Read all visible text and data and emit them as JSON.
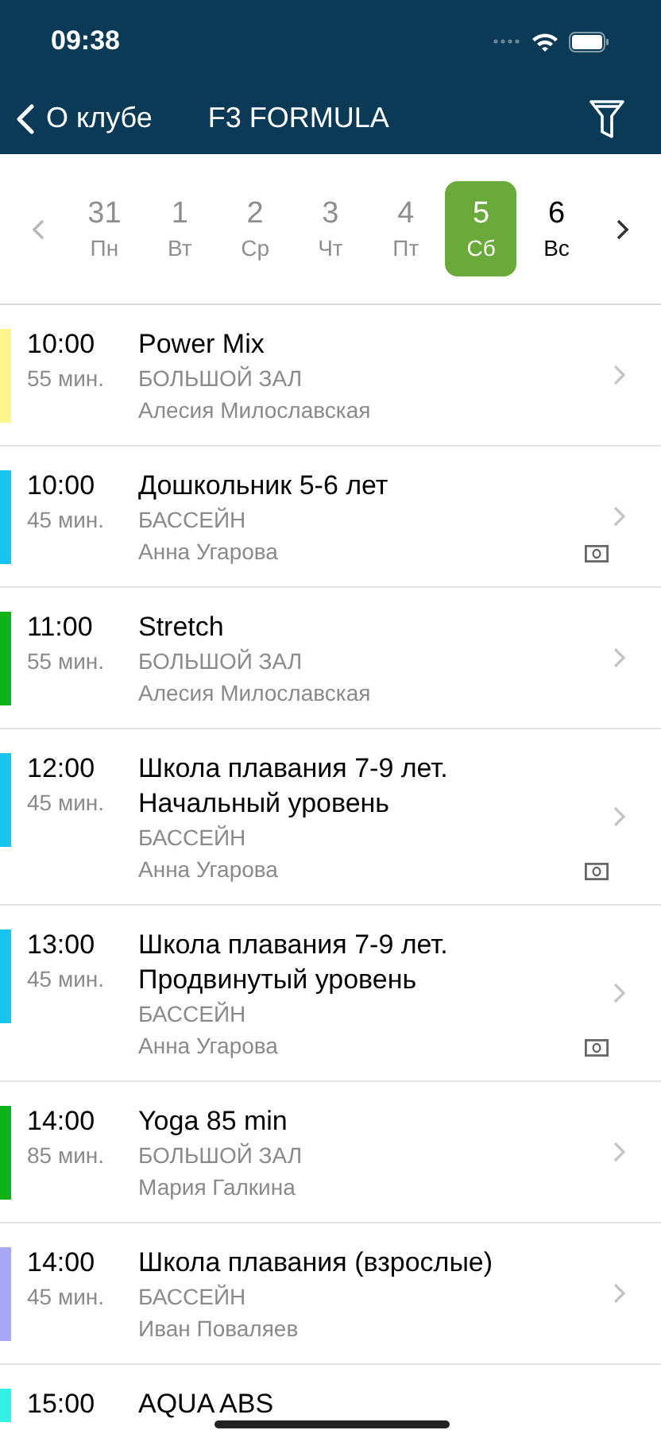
{
  "status_bar": {
    "time": "09:38"
  },
  "nav": {
    "back": "О клубе",
    "title": "F3 FORMULA"
  },
  "days": [
    {
      "number": "31",
      "weekday": "Пн",
      "past": true,
      "selected": false
    },
    {
      "number": "1",
      "weekday": "Вт",
      "past": true,
      "selected": false
    },
    {
      "number": "2",
      "weekday": "Ср",
      "past": true,
      "selected": false
    },
    {
      "number": "3",
      "weekday": "Чт",
      "past": true,
      "selected": false
    },
    {
      "number": "4",
      "weekday": "Пт",
      "past": true,
      "selected": false
    },
    {
      "number": "5",
      "weekday": "Сб",
      "past": false,
      "selected": true
    },
    {
      "number": "6",
      "weekday": "Вс",
      "past": false,
      "selected": false
    }
  ],
  "classes": [
    {
      "time": "10:00",
      "duration": "55 мин.",
      "title": "Power Mix",
      "room": "БОЛЬШОЙ ЗАЛ",
      "trainer": "Алесия Милославская",
      "color": "#fbf58a",
      "paid": false
    },
    {
      "time": "10:00",
      "duration": "45 мин.",
      "title": "Дошкольник 5-6 лет",
      "room": "БАССЕЙН",
      "trainer": "Анна Угарова",
      "color": "#17c3ef",
      "paid": true
    },
    {
      "time": "11:00",
      "duration": "55 мин.",
      "title": "Stretch",
      "room": "БОЛЬШОЙ ЗАЛ",
      "trainer": "Алесия Милославская",
      "color": "#0cb21a",
      "paid": false
    },
    {
      "time": "12:00",
      "duration": "45 мин.",
      "title": "Школа плавания 7-9 лет. Начальный уровень",
      "room": "БАССЕЙН",
      "trainer": "Анна Угарова",
      "color": "#17c3ef",
      "paid": true
    },
    {
      "time": "13:00",
      "duration": "45 мин.",
      "title": "Школа плавания 7-9 лет. Продвинутый уровень",
      "room": "БАССЕЙН",
      "trainer": "Анна Угарова",
      "color": "#17c3ef",
      "paid": true
    },
    {
      "time": "14:00",
      "duration": "85 мин.",
      "title": "Yoga 85 min",
      "room": "БОЛЬШОЙ ЗАЛ",
      "trainer": "Мария Галкина",
      "color": "#0cb21a",
      "paid": false
    },
    {
      "time": "14:00",
      "duration": "45 мин.",
      "title": "Школа плавания (взрослые)",
      "room": "БАССЕЙН",
      "trainer": "Иван Поваляев",
      "color": "#a9a6f5",
      "paid": false
    },
    {
      "time": "15:00",
      "title": "AQUA ABS",
      "color": "#33f0e6",
      "paid": false
    }
  ]
}
